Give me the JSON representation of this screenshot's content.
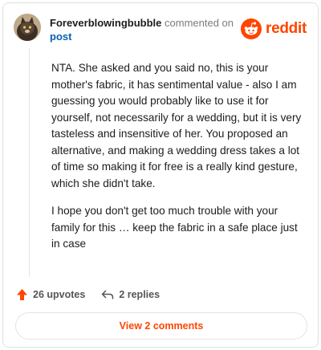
{
  "comment": {
    "username": "Foreverblowingbubble",
    "action_text": " commented on ",
    "post_link": "post",
    "paragraphs": [
      "NTA. She asked and you said no, this is your mother's fabric, it has sentimental value - also I am guessing you would probably like to use it for yourself, not necessarily for a wedding, but it is very tasteless and insensitive of her. You proposed an alternative, and making a wedding dress takes a lot of time so making it for free is a really kind gesture, which she didn't take.",
      "I hope you don't get too much trouble with your family for this … keep the fabric in a safe place just in case"
    ],
    "upvotes": "26 upvotes",
    "replies": "2 replies",
    "view_comments": "View 2 comments"
  },
  "brand": {
    "logo_text": "reddit",
    "accent_color": "#ff4500",
    "icons": [
      "reddit-logo-icon",
      "upvote-arrow-icon",
      "reply-arrow-icon"
    ]
  }
}
